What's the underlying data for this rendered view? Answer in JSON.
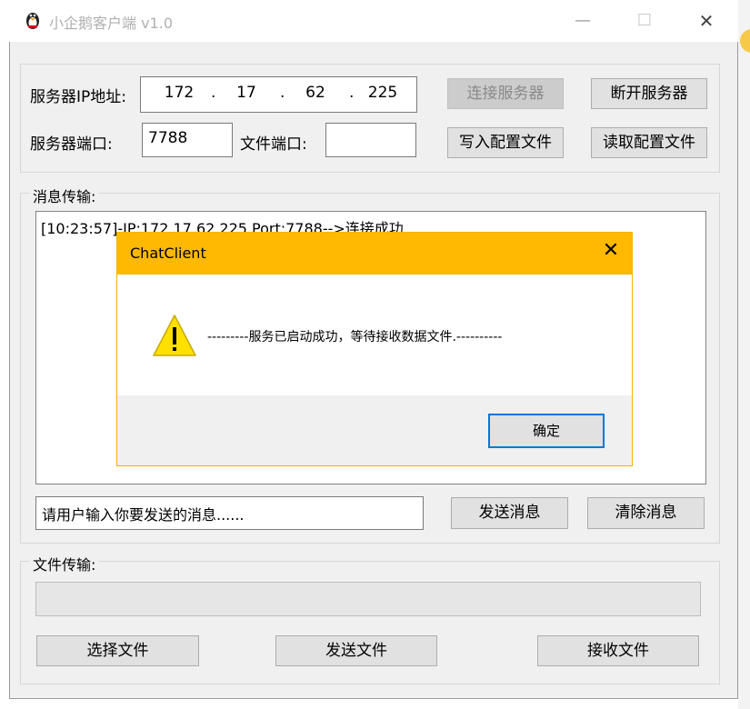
{
  "window": {
    "title": "小企鹅客户端 v1.0",
    "minimize_glyph": "—",
    "maximize_glyph": "☐",
    "close_glyph": "✕"
  },
  "server": {
    "ip_label": "服务器IP地址:",
    "ip_parts": [
      "172",
      "17",
      "62",
      "225"
    ],
    "ip_dot": ".",
    "port_label": "服务器端口:",
    "port_value": "7788",
    "file_port_label": "文件端口:",
    "file_port_value": "",
    "connect_button": "连接服务器",
    "disconnect_button": "断开服务器",
    "write_config_button": "写入配置文件",
    "read_config_button": "读取配置文件"
  },
  "messages": {
    "group_label": "消息传输:",
    "log": [
      "[10:23:57]-IP:172.17.62.225 Port:7788-->连接成功."
    ],
    "input_value": "请用户输入你要发送的消息......",
    "send_button": "发送消息",
    "clear_button": "清除消息"
  },
  "files": {
    "group_label": "文件传输:",
    "progress": 0,
    "select_button": "选择文件",
    "send_button": "发送文件",
    "receive_button": "接收文件"
  },
  "dialog": {
    "title": "ChatClient",
    "close_glyph": "✕",
    "message": "---------服务已启动成功，等待接收数据文件.----------",
    "ok_button": "确定",
    "icon": "warning-icon"
  },
  "colors": {
    "dialog_title_bg": "#ffb900",
    "ok_border": "#0078d7",
    "warning_fill": "#ffe000"
  }
}
